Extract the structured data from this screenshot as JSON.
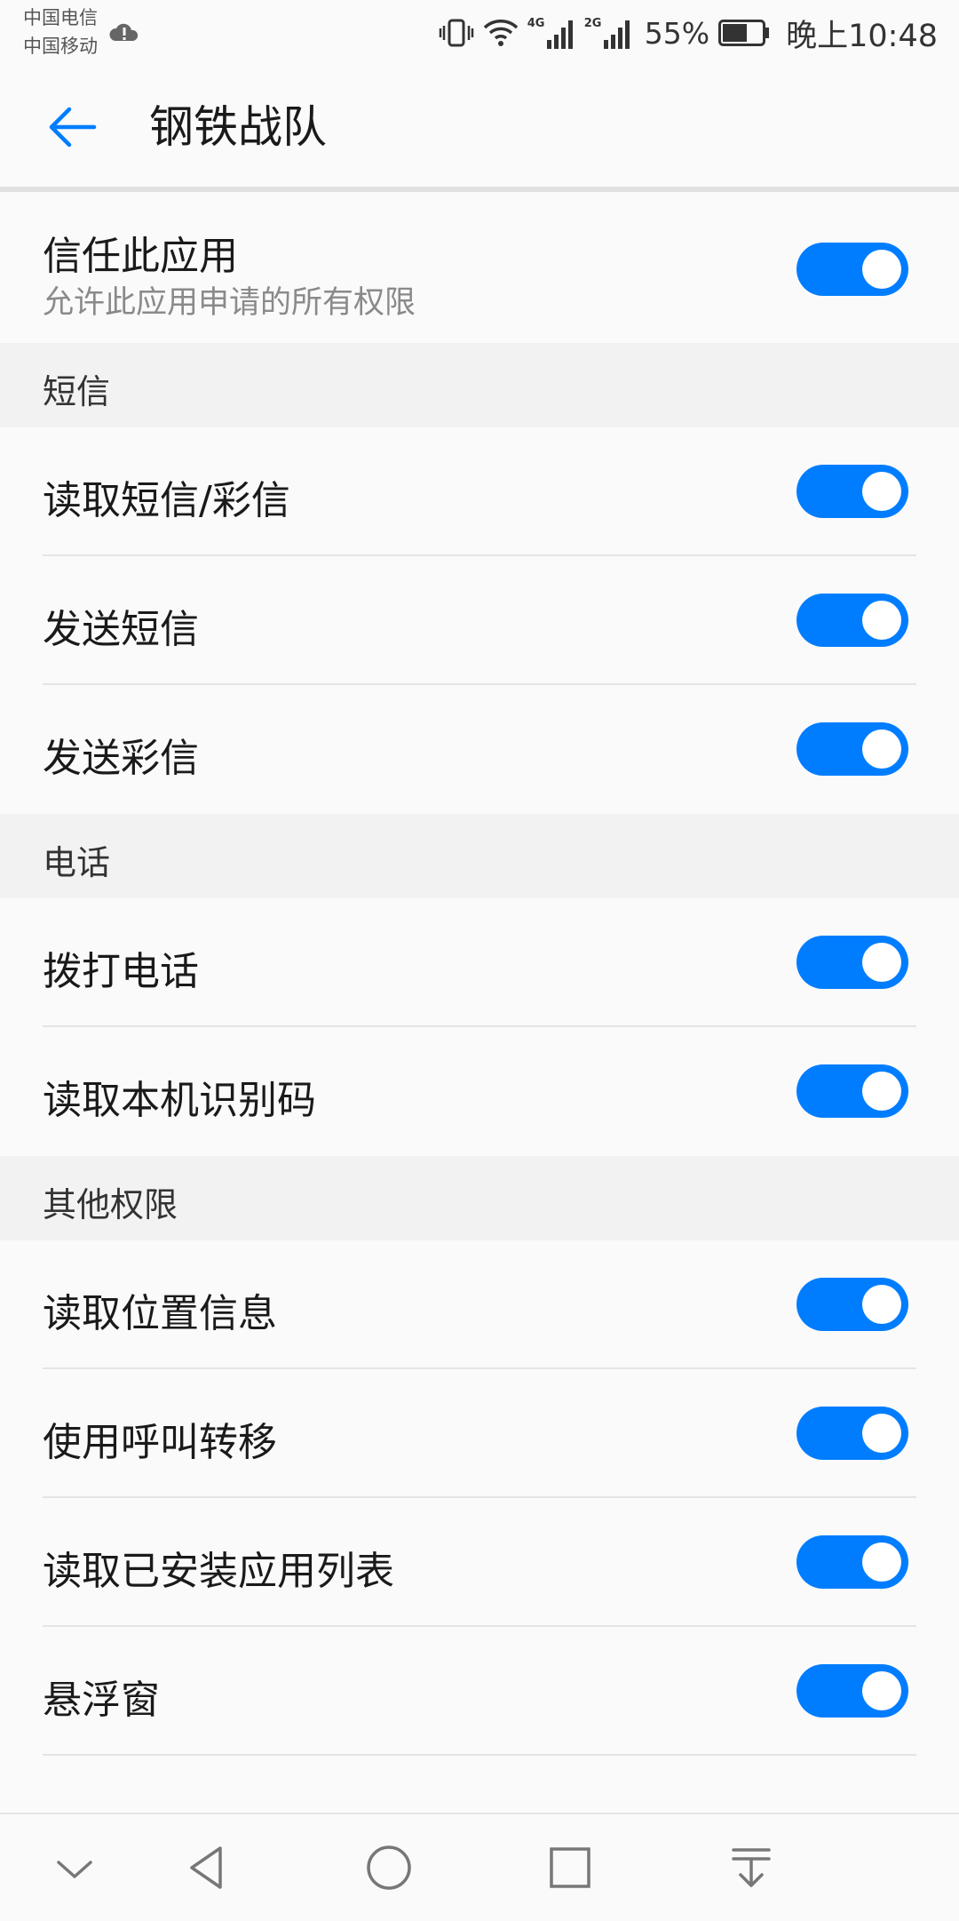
{
  "status_bar": {
    "carrier1": "中国电信",
    "carrier2": "中国移动",
    "net1": "4G",
    "net2": "2G",
    "battery_pct": "55%",
    "time": "晚上10:48"
  },
  "app_bar": {
    "title": "钢铁战队"
  },
  "trust": {
    "label": "信任此应用",
    "sub": "允许此应用申请的所有权限",
    "on": true
  },
  "sections": [
    {
      "title": "短信",
      "items": [
        {
          "label": "读取短信/彩信",
          "on": true
        },
        {
          "label": "发送短信",
          "on": true
        },
        {
          "label": "发送彩信",
          "on": true
        }
      ]
    },
    {
      "title": "电话",
      "items": [
        {
          "label": "拨打电话",
          "on": true
        },
        {
          "label": "读取本机识别码",
          "on": true
        }
      ]
    },
    {
      "title": "其他权限",
      "items": [
        {
          "label": "读取位置信息",
          "on": true
        },
        {
          "label": "使用呼叫转移",
          "on": true
        },
        {
          "label": "读取已安装应用列表",
          "on": true
        },
        {
          "label": "悬浮窗",
          "on": true
        }
      ]
    }
  ],
  "colors": {
    "accent": "#007dff",
    "background": "#fafafa",
    "section_bg": "#f2f2f2"
  },
  "icons": [
    "cloud-alert-icon",
    "vibrate-icon",
    "wifi-icon",
    "signal-icon",
    "battery-icon",
    "back-arrow-icon",
    "nav-collapse-icon",
    "nav-back-icon",
    "nav-home-icon",
    "nav-recents-icon",
    "nav-notification-icon"
  ]
}
